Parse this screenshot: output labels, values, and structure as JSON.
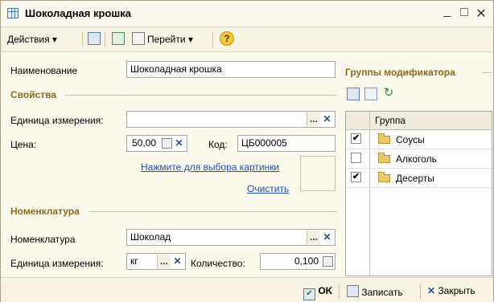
{
  "window": {
    "title": "Шоколадная крошка"
  },
  "toolbar": {
    "actions": "Действия",
    "goto": "Перейти",
    "help": "?"
  },
  "form": {
    "name_label": "Наименование",
    "name_value": "Шоколадная крошка",
    "props_section": "Свойства",
    "unit_label": "Единица измерения:",
    "unit_value": "",
    "price_label": "Цена:",
    "price_value": "50,00",
    "code_label": "Код:",
    "code_value": "ЦБ000005",
    "pick_image_link": "Нажмите для выбора картинки",
    "clear_link": "Очистить",
    "nom_section": "Номенклатура",
    "nom_label": "Номенклатура",
    "nom_value": "Шоколад",
    "unit2_label": "Единица измерения:",
    "unit2_value": "кг",
    "qty_label": "Количество:",
    "qty_value": "0,100",
    "dots": "...",
    "x": "✕"
  },
  "modifiers": {
    "section": "Группы модификатора",
    "column": "Группа",
    "rows": [
      {
        "label": "Соусы",
        "checked": "✔"
      },
      {
        "label": "Алкоголь",
        "checked": ""
      },
      {
        "label": "Десерты",
        "checked": "✔"
      }
    ]
  },
  "footer": {
    "ok": "OK",
    "save": "Записать",
    "close": "Закрыть"
  }
}
